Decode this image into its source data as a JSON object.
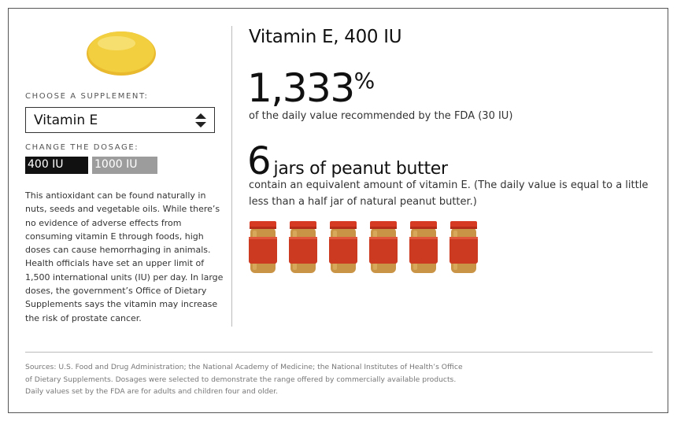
{
  "pill": {
    "icon": "supplement-pill-icon",
    "color": "#f2cf3e"
  },
  "supplement": {
    "choose_label": "CHOOSE A SUPPLEMENT:",
    "selected": "Vitamin E"
  },
  "dosage": {
    "label": "CHANGE THE DOSAGE:",
    "options": [
      {
        "label": "400 IU",
        "active": true
      },
      {
        "label": "1000 IU",
        "active": false
      }
    ]
  },
  "description": "This antioxidant can be found naturally in nuts, seeds and vegetable oils. While there’s no evidence of adverse effects from consuming vitamin E through foods, high doses can cause hemorrhaging in animals. Health officials have set an upper limit of 1,500 international units (IU) per day. In large doses, the government’s Office of Dietary Supplements says the vitamin may increase the risk of prostate cancer.",
  "result": {
    "title": "Vitamin E, 400 IU",
    "percent_value": "1,333",
    "percent_sign": "%",
    "daily_value_text": "of the daily value recommended by the FDA (30 IU)",
    "jar_count": "6",
    "jar_unit": "jars of peanut butter",
    "equivalent_text": "contain an equivalent amount of vitamin E. (The daily value is equal to a little less than a half jar of natural peanut butter.)",
    "jars_shown": 6,
    "jar_icon": "peanut-butter-jar-icon"
  },
  "colors": {
    "jar_lid": "#d63a22",
    "jar_label": "#cc3a22",
    "jar_body": "#c99446",
    "active_button": "#111111",
    "inactive_button": "#9c9c9c"
  },
  "sources": "Sources: U.S. Food and Drug Administration; the National Academy of Medicine; the National Institutes of Health’s Office of Dietary Supplements. Dosages were selected to demonstrate the range offered by commercially available products. Daily values set by the FDA are for adults and children four and older."
}
